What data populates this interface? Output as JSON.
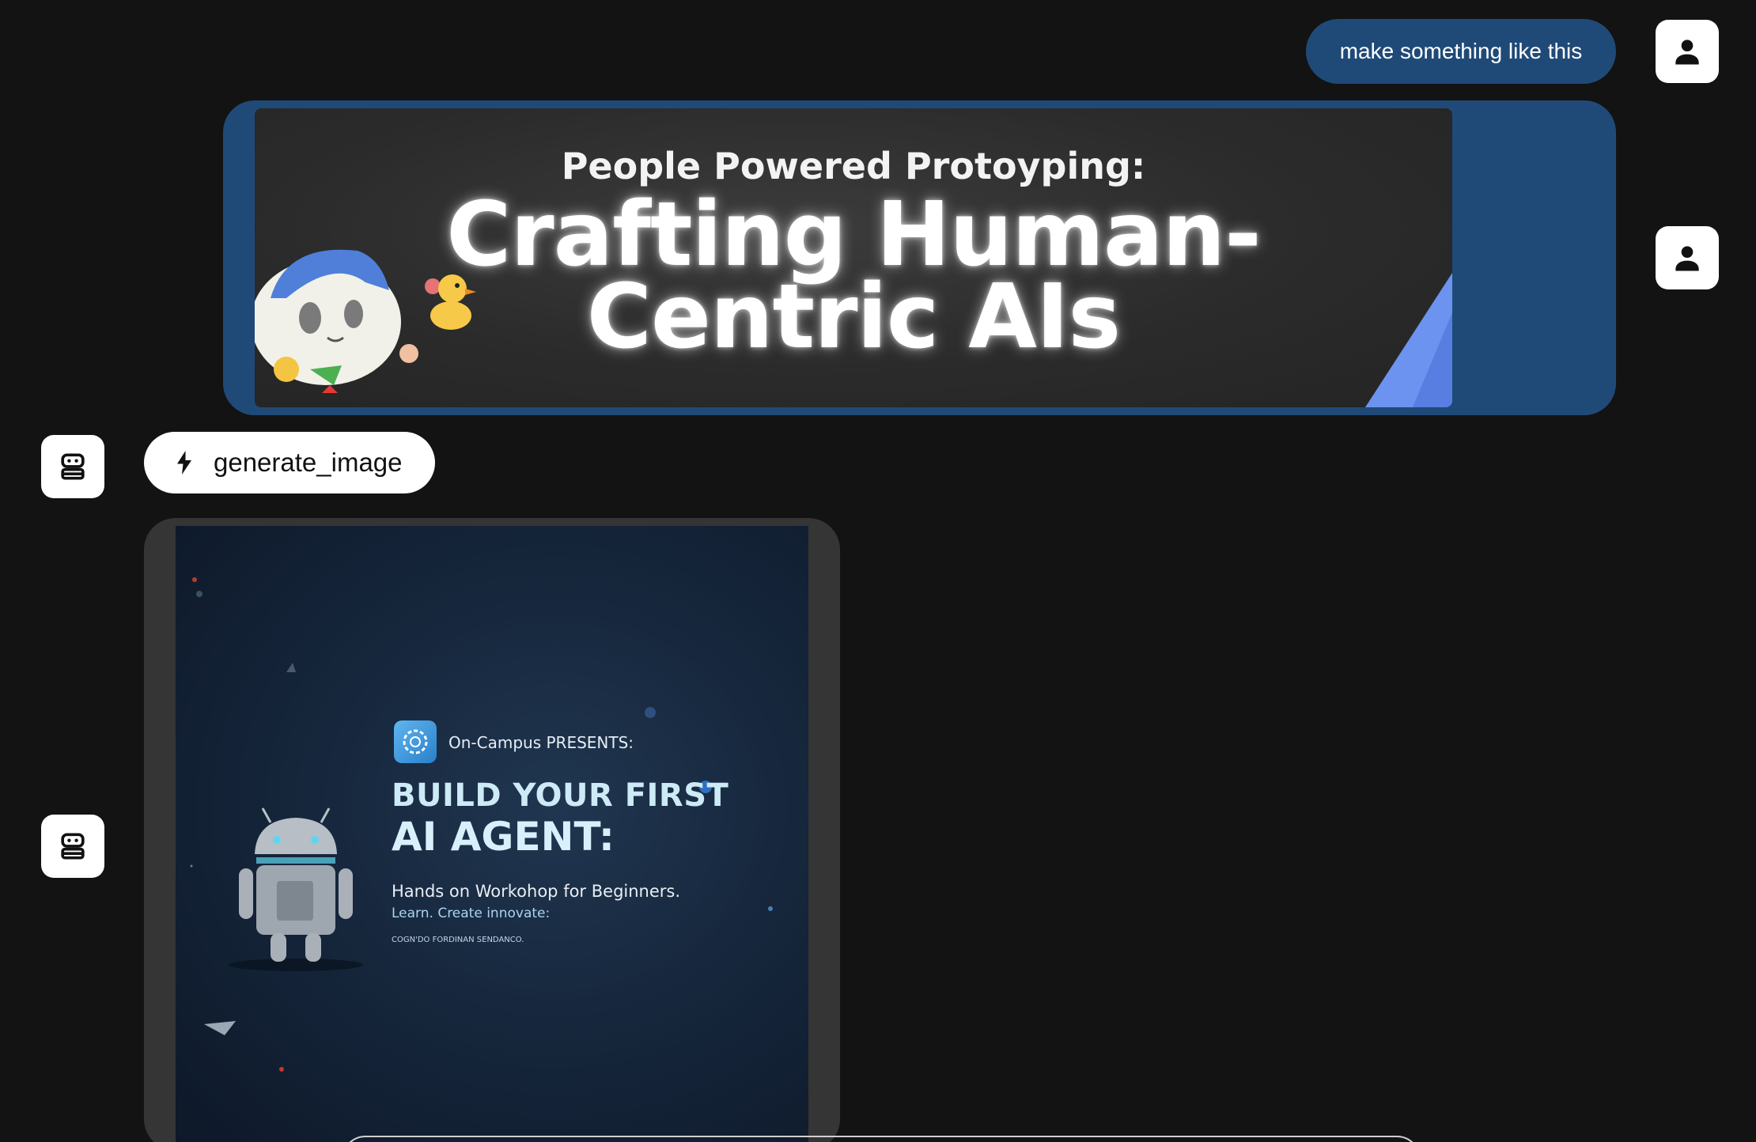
{
  "messages": {
    "user_text": "make something like this",
    "user_image": {
      "subtitle": "People Powered Protoyping:",
      "title_line1": "Crafting Human-",
      "title_line2": "Centric AIs"
    },
    "tool_call": {
      "icon": "bolt-icon",
      "label": "generate_image"
    },
    "generated_image": {
      "presents": "On-Campus PRESENTS:",
      "headline_line1": "BUILD YOUR FIRST",
      "headline_line2": "AI AGENT:",
      "description": "Hands on Workohop for Beginners.",
      "tagline": "Learn. Create innovate:",
      "fine_print": "COGN'DO FORDINAN SENDANCO."
    }
  },
  "icons": {
    "user_avatar": "person-icon",
    "assistant_avatar": "robot-icon"
  },
  "colors": {
    "background": "#131313",
    "user_bubble": "#1f4a78",
    "card": "#353535",
    "pill": "#ffffff"
  }
}
